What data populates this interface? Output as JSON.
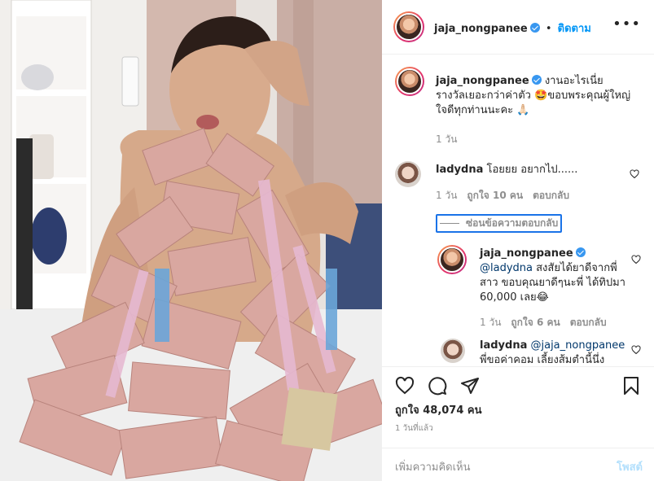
{
  "post": {
    "username": "jaja_nongpanee",
    "follow_label": "ติดตาม",
    "caption": "งานอะไรเนี่ย รางวัลเยอะกว่าค่าตัว 🤩ขอบพระคุณผู้ใหญ่ใจดีทุกท่านนะคะ 🙏🏻",
    "caption_time": "1 วัน",
    "likes": "ถูกใจ 48,074 คน",
    "posted_time": "1 วันที่แล้ว"
  },
  "comments": [
    {
      "username": "ladydna",
      "text": "โอยยย อยากไป......",
      "time": "1 วัน",
      "likes": "ถูกใจ 10 คน",
      "reply_label": "ตอบกลับ"
    }
  ],
  "replies_toggle": "ซ่อนข้อความตอบกลับ",
  "replies": [
    {
      "username": "jaja_nongpanee",
      "mention": "@ladydna",
      "text": " สงสัยได้ยาดีจากพี่สาว ขอบคุณยาดีๆนะพี่ ได้ทิปมา 60,000 เลย😂",
      "time": "1 วัน",
      "likes": "ถูกใจ 6 คน",
      "reply_label": "ตอบกลับ"
    },
    {
      "username": "ladydna",
      "mention": "@jaja_nongpanee",
      "text": " พี่ขอค่าคอม เลี้ยงส้มตำนี้นึ่ง"
    }
  ],
  "add_comment": {
    "placeholder": "เพิ่มความคิดเห็น",
    "post_label": "โพสต์"
  },
  "icons": {
    "like": "heart-icon",
    "comment": "comment-icon",
    "share": "share-icon",
    "save": "bookmark-icon",
    "more": "more-options-icon",
    "verified": "verified-badge-icon"
  },
  "colors": {
    "accent": "#0095f6",
    "text": "#262626",
    "muted": "#8e8e8e",
    "verified": "#3897f0"
  }
}
